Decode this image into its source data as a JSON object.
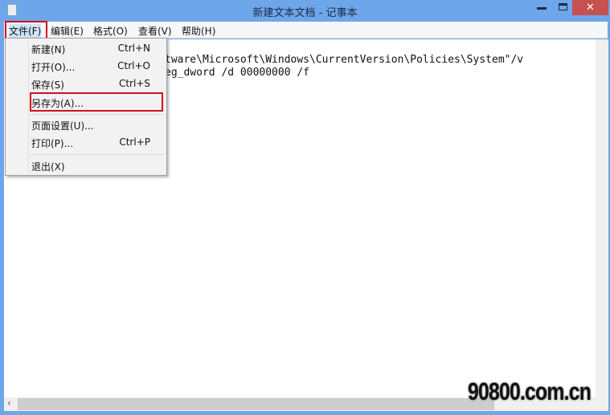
{
  "window": {
    "title": "新建文本文档 - 记事本",
    "close": "✕"
  },
  "menubar": [
    "文件(F)",
    "编辑(E)",
    "格式(O)",
    "查看(V)",
    "帮助(H)"
  ],
  "editor": {
    "lines": [
      "tware\\Microsoft\\Windows\\CurrentVersion\\Policies\\System\"/v",
      "eg_dword /d 00000000 /f"
    ]
  },
  "file_menu": [
    {
      "label": "新建(N)",
      "shortcut": "Ctrl+N"
    },
    {
      "label": "打开(O)...",
      "shortcut": "Ctrl+O"
    },
    {
      "label": "保存(S)",
      "shortcut": "Ctrl+S"
    },
    {
      "label": "另存为(A)...",
      "shortcut": ""
    },
    {
      "label": "页面设置(U)...",
      "shortcut": ""
    },
    {
      "label": "打印(P)...",
      "shortcut": "Ctrl+P"
    },
    {
      "label": "退出(X)",
      "shortcut": ""
    }
  ],
  "highlight_color": "#d0101c",
  "watermark": "90800.com.cn"
}
